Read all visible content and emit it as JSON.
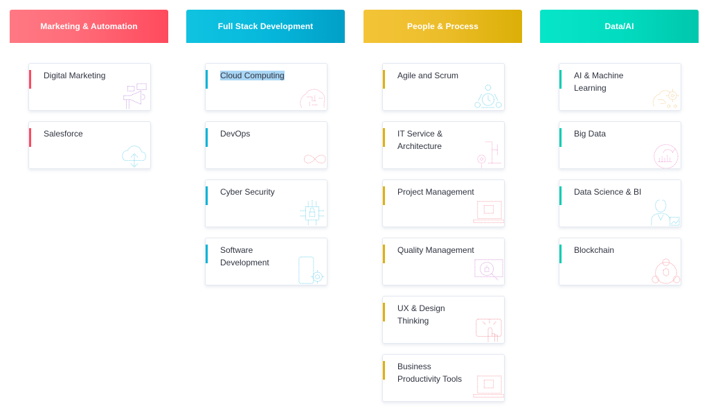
{
  "columns": [
    {
      "title": "Marketing & Automation",
      "accent": "#ff4a5d",
      "items": [
        {
          "label": "Digital Marketing",
          "icon": "megaphone-icon",
          "icon_color": "#c79ce0"
        },
        {
          "label": "Salesforce",
          "icon": "cloud-upload-icon",
          "icon_color": "#7fd6ee"
        }
      ]
    },
    {
      "title": "Full Stack Development",
      "accent": "#05b3d8",
      "items": [
        {
          "label": "Cloud Computing",
          "icon": "brain-circuit-icon",
          "icon_color": "#f7a8c2",
          "selected": true
        },
        {
          "label": "DevOps",
          "icon": "infinity-icon",
          "icon_color": "#f7a8b0"
        },
        {
          "label": "Cyber Security",
          "icon": "chip-lock-icon",
          "icon_color": "#7fd6ee"
        },
        {
          "label": "Software Development",
          "icon": "phone-gear-icon",
          "icon_color": "#7fd6ee"
        }
      ]
    },
    {
      "title": "People & Process",
      "accent": "#e0b10b",
      "items": [
        {
          "label": "Agile and Scrum",
          "icon": "team-clock-icon",
          "icon_color": "#6fd3ea"
        },
        {
          "label": "IT Service & Architecture",
          "icon": "gear-network-icon",
          "icon_color": "#f6a6cf"
        },
        {
          "label": "Project Management",
          "icon": "laptop-icon",
          "icon_color": "#f7a8b0"
        },
        {
          "label": "Quality Management",
          "icon": "magnifier-bug-icon",
          "icon_color": "#d9a2df"
        },
        {
          "label": "UX & Design Thinking",
          "icon": "touch-screen-icon",
          "icon_color": "#f49aa6"
        },
        {
          "label": "Business Productivity Tools",
          "icon": "laptop-icon",
          "icon_color": "#f7a8b0"
        }
      ]
    },
    {
      "title": "Data/AI",
      "accent": "#00cdb2",
      "items": [
        {
          "label": "AI & Machine Learning",
          "icon": "ai-brain-icon",
          "icon_color": "#f5cf96"
        },
        {
          "label": "Big Data",
          "icon": "elephant-chart-icon",
          "icon_color": "#f1a6d8"
        },
        {
          "label": "Data Science & BI",
          "icon": "analyst-icon",
          "icon_color": "#7fd6ee"
        },
        {
          "label": "Blockchain",
          "icon": "blockchain-icon",
          "icon_color": "#f7a0a8"
        }
      ]
    }
  ]
}
